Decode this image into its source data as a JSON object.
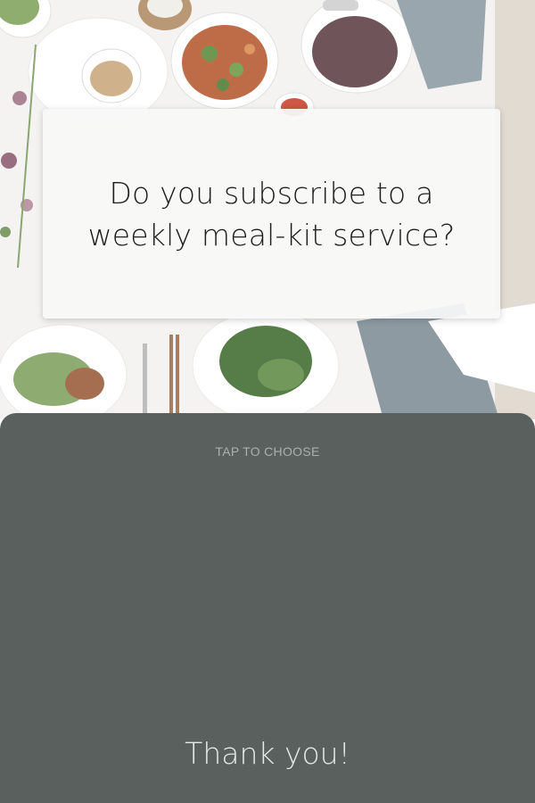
{
  "background": {
    "description_icon": "food-photo-image"
  },
  "question": {
    "text": "Do you subscribe to a weekly meal-kit service?"
  },
  "answer_panel": {
    "hint": "TAP TO CHOOSE",
    "thank_you": "Thank you!",
    "color": "#59605d"
  }
}
